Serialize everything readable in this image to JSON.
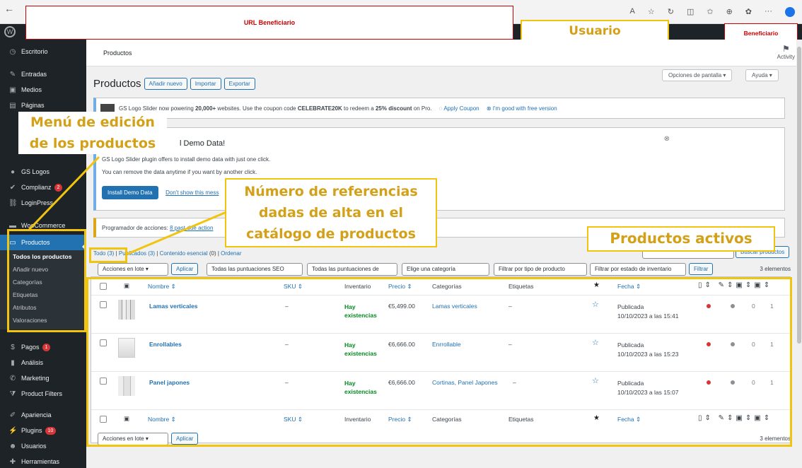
{
  "annotations": {
    "url_label": "URL Beneficiario",
    "usuario": "Usuario",
    "beneficiario": "Beneficiario",
    "menu_edicion_1": "Menú de edición",
    "menu_edicion_2": "de los productos",
    "numero_ref_1": "Número de referencias",
    "numero_ref_2": "dadas de alta en el",
    "numero_ref_3": "catálogo de productos",
    "productos_activos": "Productos activos"
  },
  "sidebar": {
    "items": [
      {
        "icon": "dashboard-icon",
        "glyph": "◷",
        "label": "Escritorio"
      },
      {
        "icon": "pin-icon",
        "glyph": "✎",
        "label": "Entradas"
      },
      {
        "icon": "media-icon",
        "glyph": "▣",
        "label": "Medios"
      },
      {
        "icon": "pages-icon",
        "glyph": "▤",
        "label": "Páginas"
      },
      {
        "icon": "gs-logos-icon",
        "glyph": "●",
        "label": "GS Logos"
      },
      {
        "icon": "check-icon",
        "glyph": "✔",
        "label": "Complianz",
        "badge": "2"
      },
      {
        "icon": "loginpress-icon",
        "glyph": "⛓",
        "label": "LoginPress"
      },
      {
        "icon": "woocommerce-icon",
        "glyph": "▬",
        "label": "WooCommerce"
      },
      {
        "icon": "products-icon",
        "glyph": "▭",
        "label": "Productos"
      },
      {
        "icon": "payments-icon",
        "glyph": "$",
        "label": "Pagos",
        "badge": "1"
      },
      {
        "icon": "analytics-icon",
        "glyph": "▮",
        "label": "Análisis"
      },
      {
        "icon": "marketing-icon",
        "glyph": "✆",
        "label": "Marketing"
      },
      {
        "icon": "filter-icon",
        "glyph": "⧩",
        "label": "Product Filters"
      },
      {
        "icon": "appearance-icon",
        "glyph": "✐",
        "label": "Apariencia"
      },
      {
        "icon": "plugins-icon",
        "glyph": "⚡",
        "label": "Plugins",
        "badge": "10"
      },
      {
        "icon": "users-icon",
        "glyph": "☻",
        "label": "Usuarios"
      },
      {
        "icon": "tools-icon",
        "glyph": "✚",
        "label": "Herramientas"
      }
    ],
    "submenu": [
      "Todos los productos",
      "Añadir nuevo",
      "Categorías",
      "Etiquetas",
      "Atributos",
      "Valoraciones"
    ]
  },
  "header": {
    "breadcrumb": "Productos",
    "activity": "Activity",
    "page_title": "Productos",
    "btn_add": "Añadir nuevo",
    "btn_import": "Importar",
    "btn_export": "Exportar",
    "screen_options": "Opciones de pantalla ▾",
    "help": "Ayuda ▾"
  },
  "notices": {
    "gs_text_a": "GS Logo Slider now powering ",
    "gs_text_b": "20,000+",
    "gs_text_c": " websites. Use the coupon code ",
    "gs_text_d": "CELEBRATE20K",
    "gs_text_e": " to redeem a ",
    "gs_text_f": "25% discount",
    "gs_text_g": " on Pro.",
    "apply_coupon": "Apply Coupon",
    "good_free": "I'm good with free version",
    "demo_title": "l Demo Data!",
    "demo_line1": "GS Logo Slider plugin offers to install demo data with just one click.",
    "demo_line2": "You can remove the data anytime if you want by another click.",
    "install_btn": "Install Demo Data",
    "dont_show": "Don't show this mess",
    "programador": "Programador de acciones: ",
    "programador_link": "8 past-due action"
  },
  "views": {
    "todo": "Todo (3)",
    "sep1": " | ",
    "publicados": "Publicados (3)",
    "contenido": "Contenido esencial",
    "contenido_count": " (0) | ",
    "ordenar": "Ordenar",
    "search_btn": "Buscar productos"
  },
  "filters": {
    "bulk": "Acciones en lote",
    "apply": "Aplicar",
    "f1": "Todas las puntuaciones SEO",
    "f2": "Todas las puntuaciones de",
    "f3": "Elige una categoría",
    "f4": "Filtrar por tipo de producto",
    "f5": "Filtrar por estado de inventario",
    "filter_btn": "Filtrar",
    "count": "3 elementos"
  },
  "table": {
    "headers": {
      "name": "Nombre ⇕",
      "sku": "SKU ⇕",
      "inventory": "Inventario",
      "price": "Precio ⇕",
      "categories": "Categorías",
      "tags": "Etiquetas",
      "date": "Fecha ⇕"
    },
    "rows": [
      {
        "name": "Lamas verticales",
        "sku": "–",
        "stock_a": "Hay",
        "stock_b": "existencias",
        "price": "€5,499.00",
        "categories": "Lamas verticales",
        "tags": "–",
        "status": "Publicada",
        "date": "10/10/2023 a las 15:41",
        "c1": "0",
        "c2": "1"
      },
      {
        "name": "Enrollables",
        "sku": "–",
        "stock_a": "Hay",
        "stock_b": "existencias",
        "price": "€6,666.00",
        "categories": "Enrrollable",
        "tags": "–",
        "status": "Publicada",
        "date": "10/10/2023 a las 15:23",
        "c1": "0",
        "c2": "1"
      },
      {
        "name": "Panel japones",
        "sku": "–",
        "stock_a": "Hay",
        "stock_b": "existencias",
        "price": "€6,666.00",
        "categories": "Cortinas, Panel Japones",
        "tags": "–",
        "status": "Publicada",
        "date": "10/10/2023 a las 15:07",
        "c1": "0",
        "c2": "1"
      }
    ]
  },
  "footer": {
    "bulk": "Acciones en lote",
    "apply": "Aplicar",
    "count": "3 elementos"
  }
}
